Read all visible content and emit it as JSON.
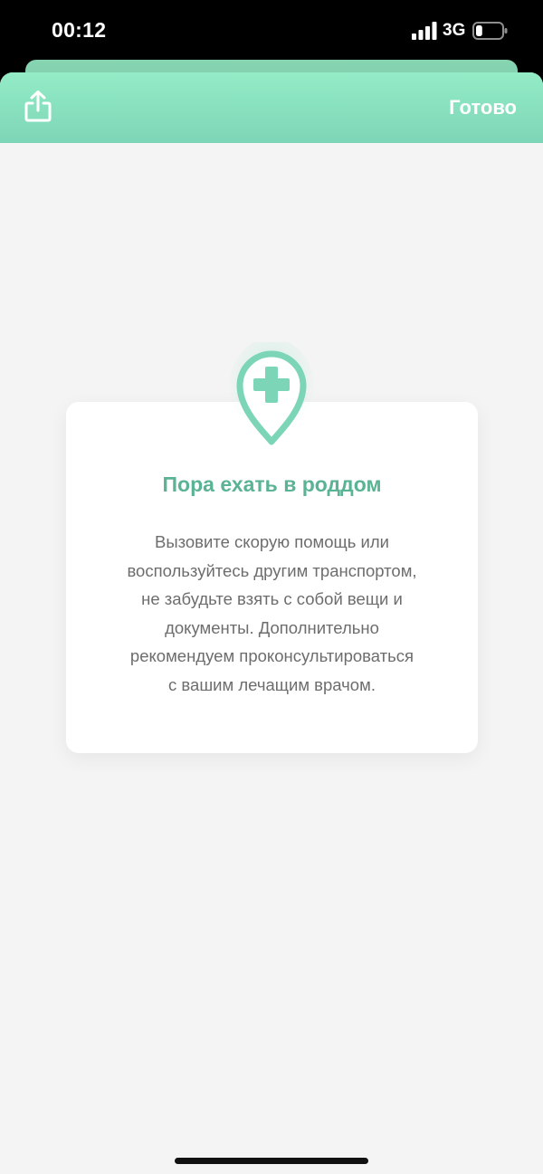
{
  "status_bar": {
    "time": "00:12",
    "network": "3G",
    "signal_bars": 4,
    "battery_level": 0.25
  },
  "header": {
    "share_icon": "share-icon",
    "done_label": "Готово"
  },
  "card": {
    "icon": "medical-location-pin-icon",
    "title": "Пора ехать в роддом",
    "body": "Вызовите скорую помощь или\nвоспользуйтесь другим транспортом,\nне забудьте взять с собой вещи и\nдокументы. Дополнительно\nрекомендуем проконсультироваться\nс вашим лечащим врачом."
  },
  "colors": {
    "accent": "#7dd5b7",
    "title": "#5ab392",
    "background": "#f4f4f4"
  }
}
